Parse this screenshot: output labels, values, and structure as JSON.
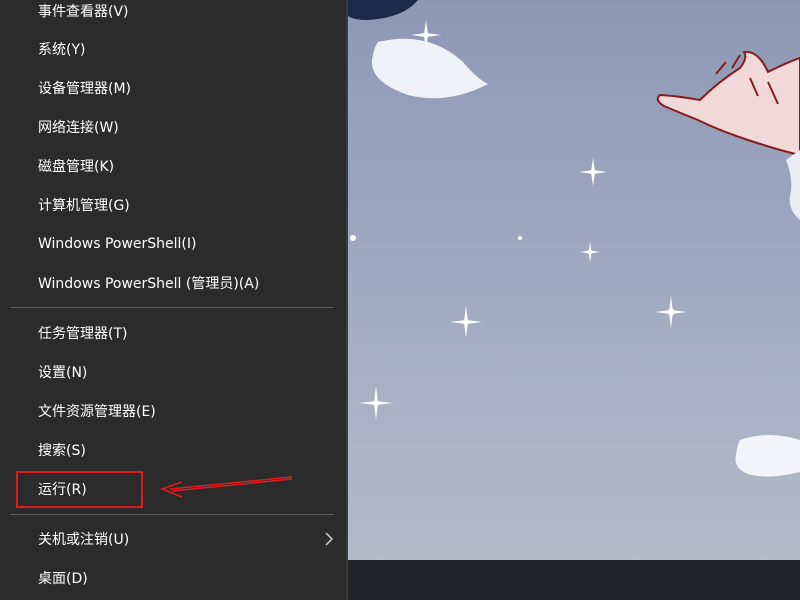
{
  "context_menu": {
    "items": [
      {
        "id": "event-viewer",
        "label": "事件查看器(V)"
      },
      {
        "id": "system",
        "label": "系统(Y)"
      },
      {
        "id": "device-manager",
        "label": "设备管理器(M)"
      },
      {
        "id": "network-connections",
        "label": "网络连接(W)"
      },
      {
        "id": "disk-management",
        "label": "磁盘管理(K)"
      },
      {
        "id": "computer-management",
        "label": "计算机管理(G)"
      },
      {
        "id": "powershell",
        "label": "Windows PowerShell(I)"
      },
      {
        "id": "powershell-admin",
        "label": "Windows PowerShell (管理员)(A)"
      },
      {
        "id": "task-manager",
        "label": "任务管理器(T)"
      },
      {
        "id": "settings",
        "label": "设置(N)"
      },
      {
        "id": "file-explorer",
        "label": "文件资源管理器(E)"
      },
      {
        "id": "search",
        "label": "搜索(S)"
      },
      {
        "id": "run",
        "label": "运行(R)"
      },
      {
        "id": "shutdown",
        "label": "关机或注销(U)",
        "has_submenu": true
      },
      {
        "id": "desktop",
        "label": "桌面(D)"
      }
    ]
  },
  "annotation": {
    "highlighted_item": "运行(R)",
    "color": "#e01b1b"
  },
  "colors": {
    "menu_bg": "#2b2b2b",
    "menu_text": "#ffffff",
    "separator": "#5a5a5a",
    "wallpaper": "#9aa5bd",
    "taskbar": "#22252c"
  }
}
